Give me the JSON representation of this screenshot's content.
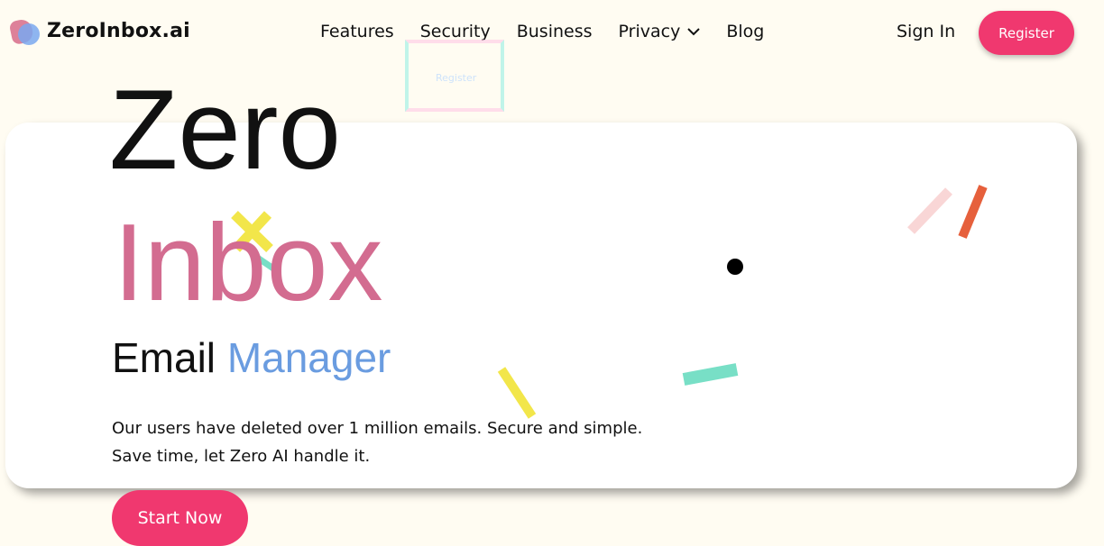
{
  "brand": {
    "name": "ZeroInbox.ai"
  },
  "nav": {
    "items": [
      "Features",
      "Security",
      "Business",
      "Privacy",
      "Blog"
    ],
    "sign_in": "Sign In",
    "register": "Register"
  },
  "hero": {
    "line1": "Zero",
    "line2": "Inbox",
    "subtitle_a": "Email",
    "subtitle_b": "Manager",
    "desc_line1": "Our users have deleted over 1 million emails. Secure and simple.",
    "desc_line2": "Save time, let Zero AI handle it.",
    "cta": "Start Now"
  },
  "ghost_text": "Register",
  "colors": {
    "accent": "#f0386f",
    "inbox": "#d36c90",
    "manager": "#6a9ce0",
    "background": "#fffcf2"
  },
  "icons": [
    "chevron-down-icon",
    "logo-icon",
    "confetti-icon"
  ]
}
